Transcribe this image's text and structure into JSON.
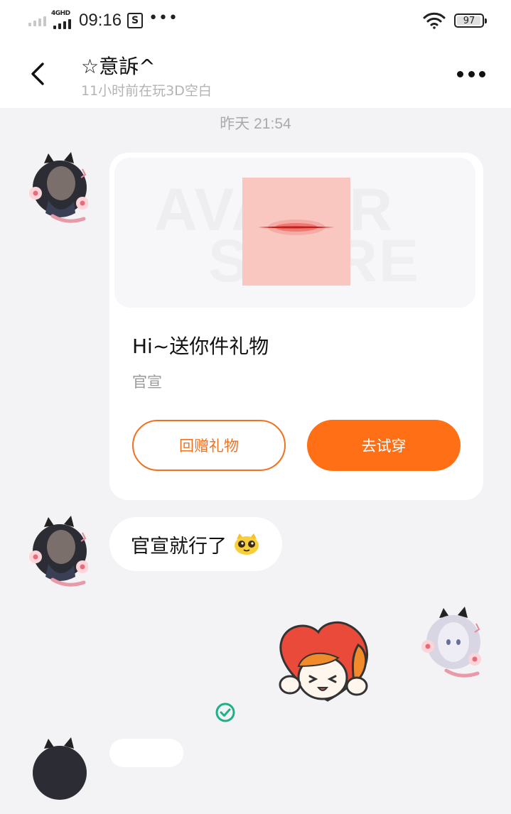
{
  "status_bar": {
    "network": "4GHD",
    "time": "09:16",
    "battery": "97",
    "battery_level": 0.97,
    "icons": [
      "signal-icon-weak",
      "signal-icon",
      "s-app-icon",
      "more-dots-icon",
      "wifi-icon",
      "battery-icon"
    ]
  },
  "header": {
    "title": "☆意訴^",
    "subtitle": "11小时前在玩3D空白",
    "icons": [
      "back-arrow-icon",
      "more-options-icon"
    ]
  },
  "chat": {
    "timestamp": "昨天 21:54",
    "gift_card": {
      "title": "Hi~送你件礼物",
      "subtitle": "官宣",
      "return_gift_label": "回赠礼物",
      "try_on_label": "去试穿",
      "accent_color": "#ff6f16"
    },
    "message": {
      "text": "官宣就行了"
    }
  }
}
